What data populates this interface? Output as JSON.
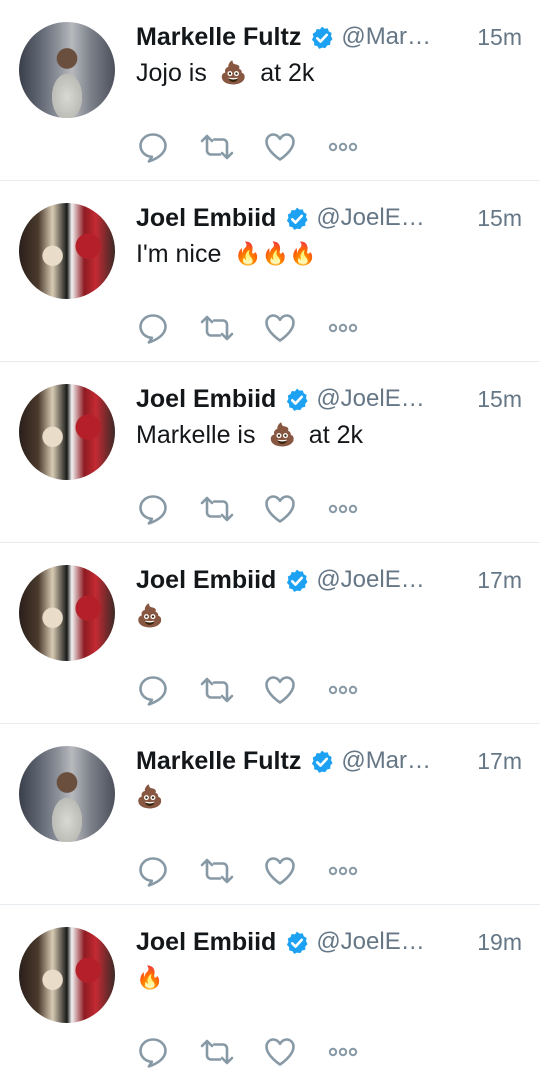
{
  "tweets": [
    {
      "author": "Markelle Fultz",
      "handle": "@Mar…",
      "time": "15m",
      "text_before": "Jojo is",
      "emoji": "💩",
      "text_after": "at 2k"
    },
    {
      "author": "Joel Embiid",
      "handle": "@JoelE…",
      "time": "15m",
      "text_before": "I'm nice",
      "emoji": "🔥🔥🔥",
      "text_after": ""
    },
    {
      "author": "Joel Embiid",
      "handle": "@JoelE…",
      "time": "15m",
      "text_before": "Markelle is",
      "emoji": "💩",
      "text_after": "at 2k"
    },
    {
      "author": "Joel Embiid",
      "handle": "@JoelE…",
      "time": "17m",
      "text_before": "",
      "emoji": "💩",
      "text_after": ""
    },
    {
      "author": "Markelle Fultz",
      "handle": "@Mar…",
      "time": "17m",
      "text_before": "",
      "emoji": "💩",
      "text_after": ""
    },
    {
      "author": "Joel Embiid",
      "handle": "@JoelE…",
      "time": "19m",
      "text_before": "",
      "emoji": "🔥",
      "text_after": ""
    }
  ],
  "icons": {
    "reply": "reply-icon",
    "retweet": "retweet-icon",
    "like": "heart-icon",
    "more": "more-icon",
    "verified": "verified-badge-icon"
  },
  "colors": {
    "verified": "#1da1f2",
    "icon": "#8899a6",
    "meta": "#657786"
  }
}
